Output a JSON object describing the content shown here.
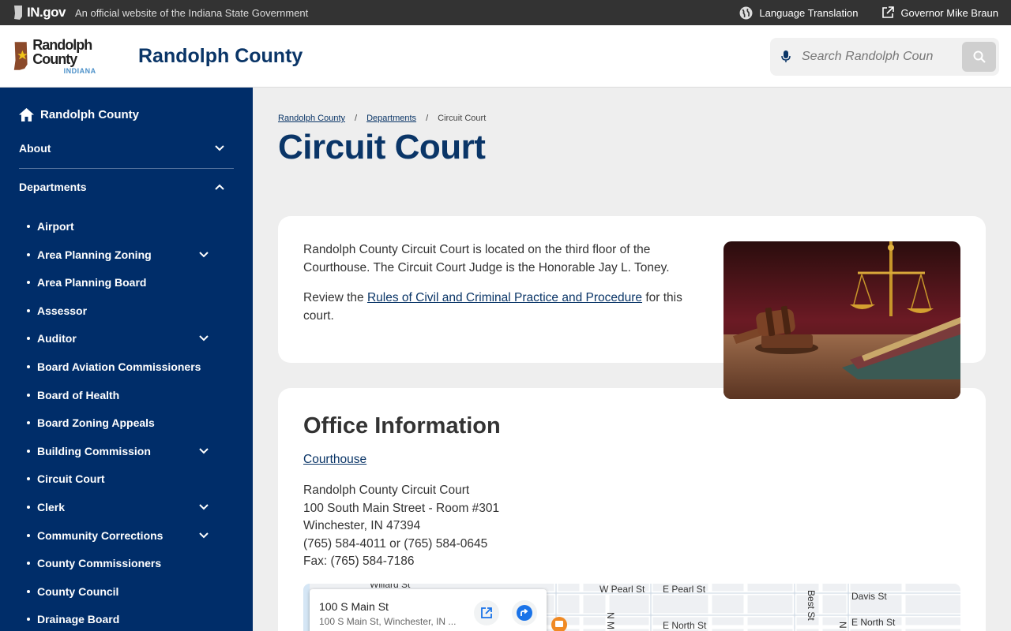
{
  "topbar": {
    "brand": "IN.gov",
    "official": "An official website of the Indiana State Government",
    "language": "Language Translation",
    "governor": "Governor Mike Braun"
  },
  "header": {
    "logo_county": "Randolph County",
    "logo_state": "INDIANA",
    "title": "Randolph County",
    "search_placeholder": "Search Randolph Coun"
  },
  "sidebar": {
    "home": "Randolph County",
    "about": "About",
    "departments": "Departments",
    "items": [
      {
        "label": "Airport",
        "expandable": false
      },
      {
        "label": "Area Planning Zoning",
        "expandable": true
      },
      {
        "label": "Area Planning Board",
        "expandable": false
      },
      {
        "label": "Assessor",
        "expandable": false
      },
      {
        "label": "Auditor",
        "expandable": true
      },
      {
        "label": "Board Aviation Commissioners",
        "expandable": false
      },
      {
        "label": "Board of Health",
        "expandable": false
      },
      {
        "label": "Board Zoning Appeals",
        "expandable": false
      },
      {
        "label": "Building Commission",
        "expandable": true
      },
      {
        "label": "Circuit Court",
        "expandable": false
      },
      {
        "label": "Clerk",
        "expandable": true
      },
      {
        "label": "Community Corrections",
        "expandable": true
      },
      {
        "label": "County Commissioners",
        "expandable": false
      },
      {
        "label": "County Council",
        "expandable": false
      },
      {
        "label": "Drainage Board",
        "expandable": false
      }
    ]
  },
  "breadcrumb": [
    "Randolph County",
    "Departments",
    "Circuit Court"
  ],
  "page_title": "Circuit Court",
  "intro": {
    "p1": "Randolph County Circuit Court is located on the third floor of the Courthouse. The Circuit Court Judge is the Honorable Jay L. Toney.",
    "p2_before": "Review the ",
    "p2_link": "Rules of Civil and Criminal Practice and Procedure",
    "p2_after": " for this court."
  },
  "office": {
    "heading": "Office Information",
    "location_link": "Courthouse",
    "address_lines": [
      "Randolph County Circuit Court",
      "100 South Main Street - Room #301",
      "Winchester, IN 47394",
      "(765) 584-4011 or (765) 584-0645",
      "Fax: (765) 584-7186"
    ]
  },
  "map": {
    "place_title": "100 S Main St",
    "place_subtitle": "100 S Main St, Winchester, IN ...",
    "streets": [
      "Willard St",
      "W Pearl St",
      "E Pearl St",
      "Davis St",
      "E North St",
      "E North St",
      "Best St",
      "N M",
      "N"
    ]
  }
}
